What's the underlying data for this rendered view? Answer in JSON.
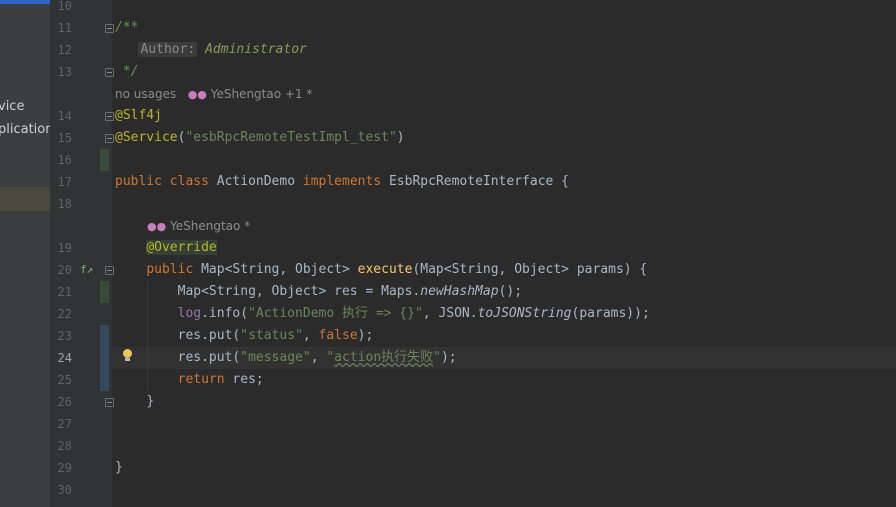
{
  "project_panel": {
    "items": [
      "vice",
      "plication"
    ]
  },
  "gutter": {
    "line_numbers": [
      "10",
      "11",
      "12",
      "13",
      "14",
      "15",
      "16",
      "17",
      "18",
      "19",
      "20",
      "21",
      "22",
      "23",
      "24",
      "25",
      "26",
      "27",
      "28",
      "29",
      "30"
    ],
    "current_line": "24"
  },
  "code": {
    "l11_open": "/**",
    "l12_tag": "Author:",
    "l12_value": "Administrator",
    "l13_close": " */",
    "meta1_usages": "no usages",
    "meta1_author": "YeShengtao +1 *",
    "l14_annotation": "@Slf4j",
    "l15_annotation": "@Service",
    "l15_paren_open": "(",
    "l15_string": "\"esbRpcRemoteTestImpl_test\"",
    "l15_paren_close": ")",
    "l17_public": "public",
    "l17_class": "class",
    "l17_name": "ActionDemo",
    "l17_implements": "implements",
    "l17_iface": "EsbRpcRemoteInterface {",
    "meta2_author": "YeShengtao *",
    "l19_annotation": "@Override",
    "l20_public": "public",
    "l20_type": "Map<String, Object>",
    "l20_method": "execute",
    "l20_params": "(Map<String, Object> params) {",
    "l21_decl": "Map<String, Object> res = Maps.",
    "l21_call": "newHashMap",
    "l21_end": "();",
    "l22_log": "log",
    "l22_info": ".info(",
    "l22_string": "\"ActionDemo 执行 => {}\"",
    "l22_mid": ", JSON.",
    "l22_call": "toJSONString",
    "l22_end": "(params));",
    "l23_start": "res.put(",
    "l23_string": "\"status\"",
    "l23_comma": ", ",
    "l23_false": "false",
    "l23_end": ");",
    "l24_start": "res.put(",
    "l24_string1": "\"message\"",
    "l24_comma": ", ",
    "l24_q1": "\"",
    "l24_text": "action执行失败",
    "l24_q2": "\"",
    "l24_end": ");",
    "l25_return": "return",
    "l25_rest": " res;",
    "l26_brace": "}",
    "l29_brace": "}"
  },
  "colors": {
    "background": "#2b2b2b",
    "keyword": "#cc7832",
    "string": "#6a8759",
    "annotation": "#bbb529",
    "method": "#ffc66d",
    "field": "#9876aa",
    "doc_comment": "#629755"
  }
}
